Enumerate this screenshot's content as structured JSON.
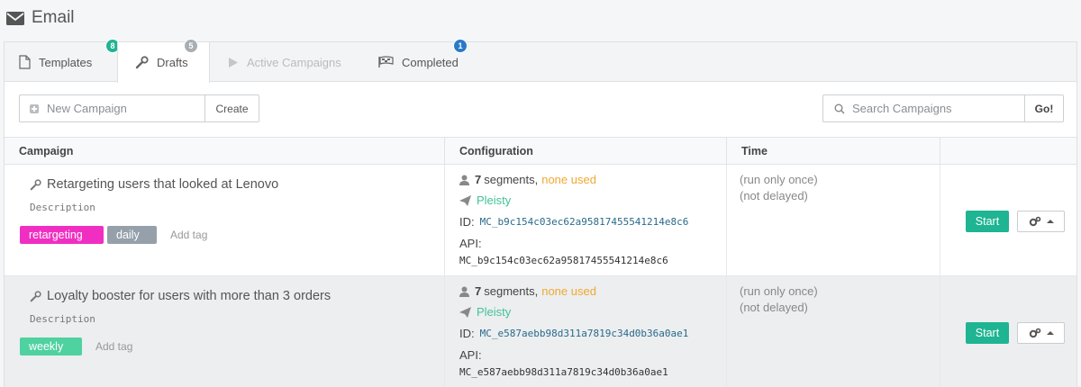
{
  "header": {
    "title": "Email",
    "icon": "envelope-icon"
  },
  "tabs": [
    {
      "label": "Templates",
      "icon": "file-icon",
      "badge": "8",
      "badge_color": "#1fb492"
    },
    {
      "label": "Drafts",
      "icon": "wrench-icon",
      "badge": "5",
      "badge_color": "#a9aeb2"
    },
    {
      "label": "Active Campaigns",
      "icon": "play-icon"
    },
    {
      "label": "Completed",
      "icon": "flag-checkered-icon",
      "badge": "1",
      "badge_color": "#2a7ac8"
    }
  ],
  "toolbar": {
    "new_placeholder": "New Campaign",
    "create_label": "Create",
    "search_placeholder": "Search Campaigns",
    "go_label": "Go!"
  },
  "table": {
    "columns": [
      "Campaign",
      "Configuration",
      "Time"
    ],
    "rows": [
      {
        "name": "Retargeting users that looked at Lenovo",
        "description": "Description",
        "tags": [
          {
            "label": "retargeting",
            "color": "#f02fc2"
          },
          {
            "label": "daily",
            "color": "#95a0aa"
          }
        ],
        "add_tag": "Add tag",
        "segments_count": "7",
        "segments_label": "segments,",
        "none_used": "none used",
        "channel": "Pleisty",
        "id_label": "ID:",
        "id_value": "MC_b9c154c03ec62a95817455541214e8c6",
        "api_label": "API:",
        "api_value": "MC_b9c154c03ec62a95817455541214e8c6",
        "time_1": "(run only once)",
        "time_2": "(not delayed)",
        "start_label": "Start"
      },
      {
        "name": "Loyalty booster for users with more than 3 orders",
        "description": "Description",
        "tags": [
          {
            "label": "weekly",
            "color": "#4fd1a0"
          }
        ],
        "add_tag": "Add tag",
        "segments_count": "7",
        "segments_label": "segments,",
        "none_used": "none used",
        "channel": "Pleisty",
        "id_label": "ID:",
        "id_value": "MC_e587aebb98d311a7819c34d0b36a0ae1",
        "api_label": "API:",
        "api_value": "MC_e587aebb98d311a7819c34d0b36a0ae1",
        "time_1": "(run only once)",
        "time_2": "(not delayed)",
        "start_label": "Start"
      }
    ]
  },
  "colors": {
    "accent": "#1fb492",
    "warning": "#f0a830",
    "pleisty": "#43c29a"
  }
}
